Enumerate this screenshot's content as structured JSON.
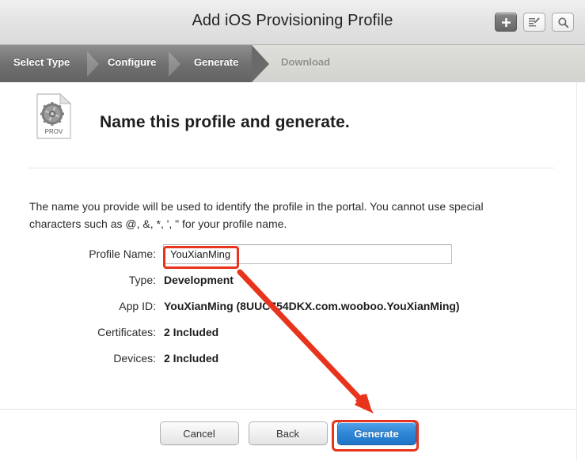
{
  "window": {
    "title": "Add iOS Provisioning Profile",
    "buttons": [
      {
        "name": "add-button",
        "icon": "plus-icon",
        "label": "+"
      },
      {
        "name": "edit-button",
        "icon": "compose-icon",
        "label": ""
      },
      {
        "name": "search-button",
        "icon": "search-icon",
        "label": ""
      }
    ]
  },
  "steps": [
    {
      "label": "Select Type",
      "state": "done"
    },
    {
      "label": "Configure",
      "state": "done"
    },
    {
      "label": "Generate",
      "state": "active"
    },
    {
      "label": "Download",
      "state": "pending"
    }
  ],
  "header": {
    "icon_label": "PROV",
    "icon_name": "provisioning-profile-icon",
    "title": "Name this profile and generate."
  },
  "blurb": "The name you provide will be used to identify the profile in the portal. You cannot use special characters such as @, &, *, ', \" for your profile name.",
  "form": {
    "profile_name": {
      "label": "Profile Name:",
      "value": "YouXianMing",
      "placeholder": ""
    },
    "rows": [
      {
        "label": "Type:",
        "value": "Development"
      },
      {
        "label": "App ID:",
        "value": "YouXianMing (8UUC754DKX.com.wooboo.YouXianMing)"
      },
      {
        "label": "Certificates:",
        "value": "2 Included"
      },
      {
        "label": "Devices:",
        "value": "2 Included"
      }
    ]
  },
  "footer": {
    "cancel_label": "Cancel",
    "back_label": "Back",
    "generate_label": "Generate"
  },
  "colors": {
    "accent_blue": "#2f86d6",
    "annotation_red": "#e8341c",
    "step_active_bar": "#6f6f6f"
  }
}
